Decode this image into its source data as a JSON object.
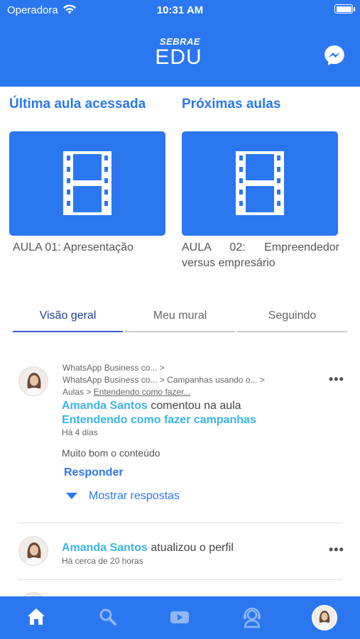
{
  "status_bar": {
    "carrier": "Operadora",
    "time": "10:31 AM"
  },
  "header": {
    "logo_top": "SEBRAE",
    "logo_bottom": "EDU",
    "messenger_icon": "messenger-icon"
  },
  "sections": {
    "last_lesson_title": "Última aula acessada",
    "next_lessons_title": "Próximas aulas",
    "last_lesson_caption": "AULA 01: Apresentação",
    "next_lesson_caption_1": "AULA 02: Empreendedor",
    "next_lesson_caption_2": "versus empresário"
  },
  "tabs": {
    "overview": "Visão geral",
    "my_wall": "Meu mural",
    "following": "Seguindo"
  },
  "feed": [
    {
      "crumb_1": "WhatsApp Business co... >",
      "crumb_2": "WhatsApp Business co... > Campanhas usando o... >",
      "crumb_3a": "Aulas > ",
      "crumb_3b": "Entendendo como fazer...",
      "user": "Amanda Santos",
      "action": " comentou na aula",
      "lesson": "Entendendo como fazer campanhas",
      "time": "Há 4 dias",
      "text": "Muito bom o conteúdo",
      "reply": "Responder",
      "show_replies": "Mostrar respostas",
      "more": "•••"
    },
    {
      "user": "Amanda Santos",
      "action": " atualizou o perfil",
      "time": "Há cerca de 20 horas",
      "more": "•••"
    }
  ],
  "tabbar": {
    "items": [
      "home-icon",
      "search-icon",
      "video-icon",
      "support-icon",
      "profile-avatar"
    ],
    "active": "home-icon"
  },
  "colors": {
    "primary": "#2b77f0",
    "name_accent": "#3ab4e8",
    "active_tab": "#1f3fa8"
  }
}
